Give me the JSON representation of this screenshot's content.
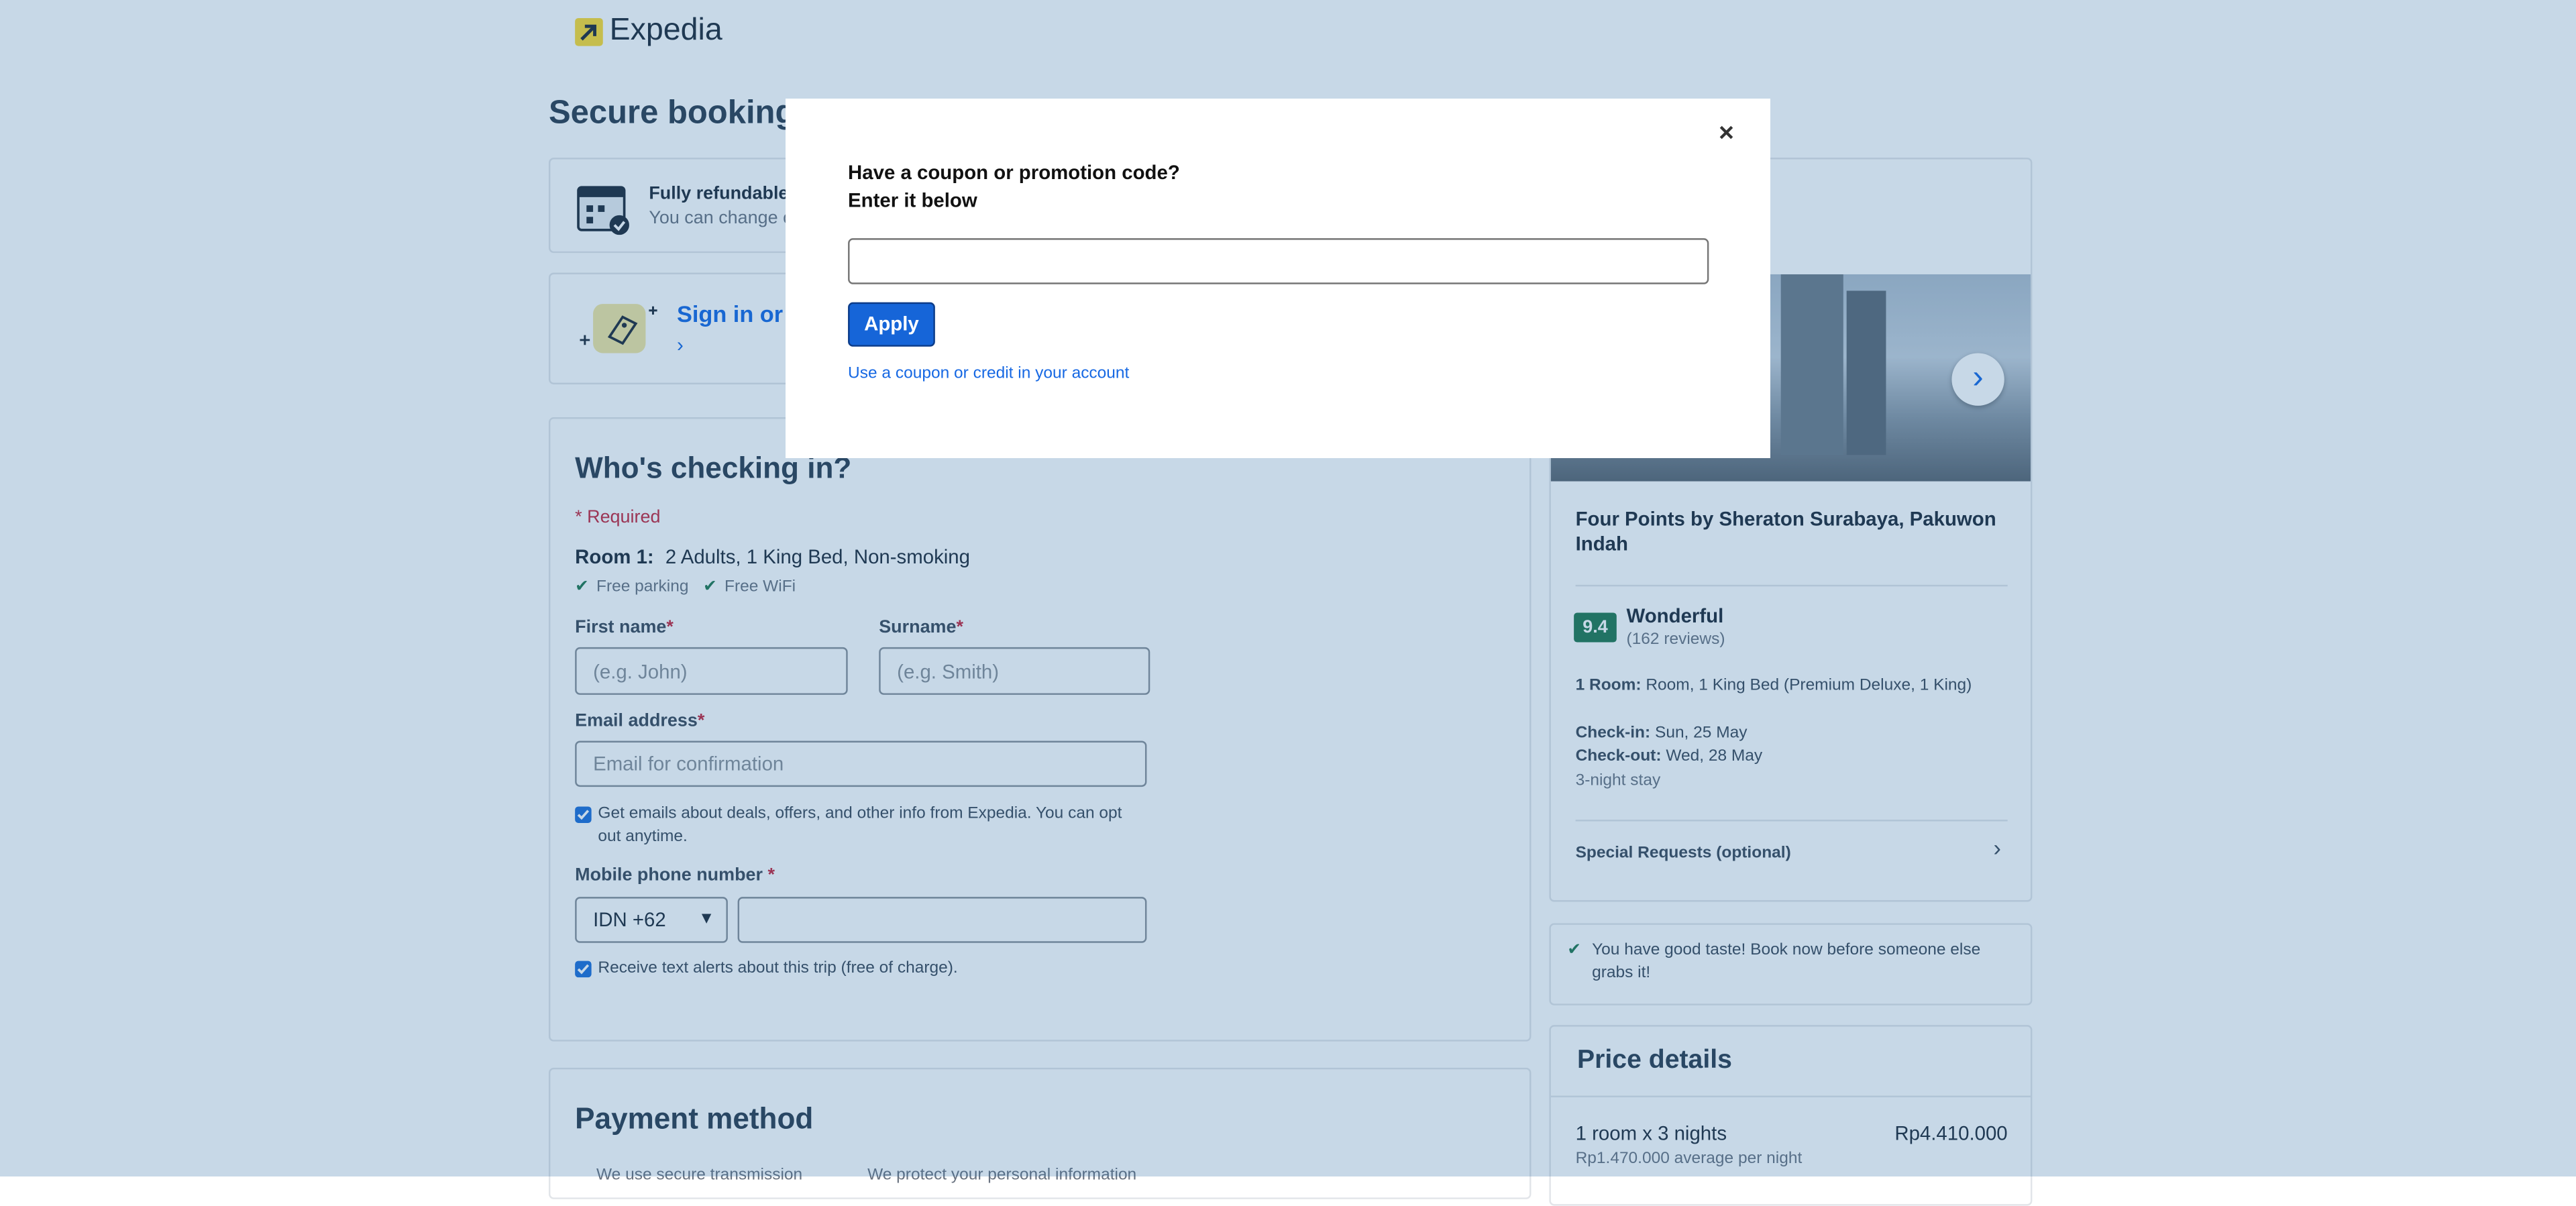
{
  "brand": {
    "name": "Expedia"
  },
  "page": {
    "title": "Secure booking"
  },
  "refund": {
    "title": "Fully refundable",
    "subtitle": "You can change o"
  },
  "signin": {
    "text": "Sign in or c"
  },
  "checkin": {
    "heading": "Who's checking in?",
    "required_note": "* Required",
    "room_label": "Room 1:",
    "room_desc": "2 Adults, 1 King Bed, Non-smoking",
    "amenities": [
      "Free parking",
      "Free WiFi"
    ],
    "first_name": {
      "label": "First name",
      "placeholder": "(e.g. John)"
    },
    "surname": {
      "label": "Surname",
      "placeholder": "(e.g. Smith)"
    },
    "email": {
      "label": "Email address",
      "placeholder": "Email for confirmation"
    },
    "email_optin": "Get emails about deals, offers, and other info from Expedia. You can opt out anytime.",
    "phone": {
      "label": "Mobile phone number",
      "country": "IDN +62",
      "value": ""
    },
    "sms_optin": "Receive text alerts about this trip (free of charge)."
  },
  "payment": {
    "heading": "Payment method",
    "notes": [
      "We use secure transmission",
      "We protect your personal information"
    ]
  },
  "hotel": {
    "name": "Four Points by Sheraton Surabaya, Pakuwon Indah",
    "rating": "9.4",
    "rating_word": "Wonderful",
    "reviews": "(162 reviews)",
    "room_label": "1 Room:",
    "room_value": "Room, 1 King Bed (Premium Deluxe, 1 King)",
    "checkin_label": "Check-in:",
    "checkin_value": "Sun, 25 May",
    "checkout_label": "Check-out:",
    "checkout_value": "Wed, 28 May",
    "stay": "3-night stay",
    "special_requests": "Special Requests (optional)"
  },
  "taste": "You have good taste! Book now before someone else grabs it!",
  "price": {
    "heading": "Price details",
    "line_label": "1 room x 3 nights",
    "line_value": "Rp4.410.000",
    "avg": "Rp1.470.000 average per night"
  },
  "modal": {
    "title_line1": "Have a coupon or promotion code?",
    "title_line2": "Enter it below",
    "input_value": "",
    "apply_label": "Apply",
    "account_link": "Use a coupon or credit in your account",
    "close_symbol": "×"
  },
  "colors": {
    "brand_yellow": "#fddb32",
    "primary_blue": "#1e6fd9",
    "link_blue": "#1668e3",
    "rating_green": "#227950",
    "overlay": "#c8dbe9"
  }
}
